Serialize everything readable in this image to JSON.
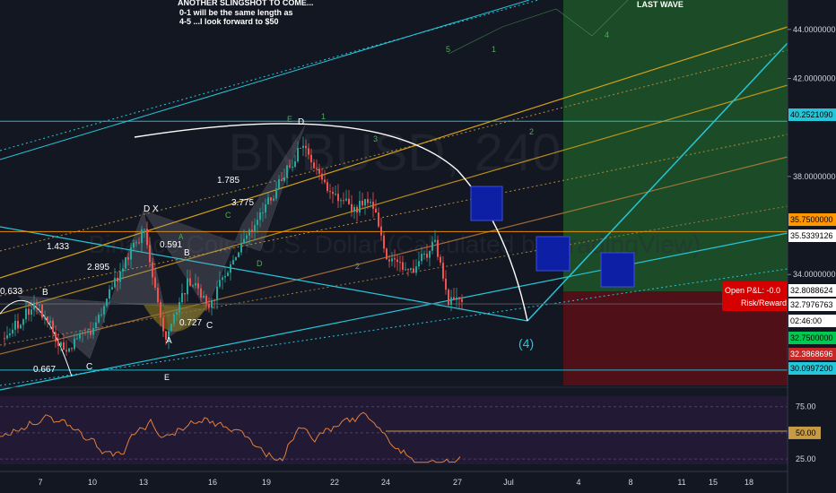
{
  "chart_data": {
    "type": "line",
    "symbol": "BNBUSD, 240",
    "description": "Binance Coin / U.S. Dollar (Calculated by TradingView)",
    "notes": [
      "ANOTHER SLINGSHOT TO COME...",
      "0-1 will be the same length as",
      "4-5 ...I look forward to $50"
    ],
    "label_last_wave": "LAST WAVE",
    "x_ticks": [
      "7",
      "10",
      "13",
      "16",
      "19",
      "22",
      "24",
      "27",
      "Jul",
      "4",
      "8",
      "11",
      "15",
      "18"
    ],
    "price_scale": {
      "ylim": [
        29.4,
        45.2
      ],
      "ticks": [
        "44.0000000",
        "42.0000000",
        "38.0000000",
        "34.0000000"
      ],
      "tick_values": [
        44,
        42,
        38,
        34
      ],
      "levels": [
        {
          "label": "40.2521090",
          "value": 40.2521,
          "color": "#26c6da",
          "text": "#000000"
        },
        {
          "label": "35.7500000",
          "value": 35.75,
          "color": "#ff9800",
          "text": "#000000"
        },
        {
          "label": "35.5339126",
          "value": 35.5339,
          "color": "#ffffff",
          "text": "#000000"
        },
        {
          "label": "32.8088624",
          "value": 32.8089,
          "color": "#ffffff",
          "text": "#000000"
        },
        {
          "label": "32.7976763",
          "value": 32.7977,
          "color": "#ffffff",
          "text": "#000000"
        },
        {
          "label": "02:46:00",
          "value": 32.3,
          "color": "#ffffff",
          "text": "#000000"
        },
        {
          "label": "32.7500000",
          "value": 32.75,
          "color": "#00c853",
          "text": "#000000"
        },
        {
          "label": "32.3868696",
          "value": 32.3869,
          "color": "#c62828",
          "text": "#ffffff"
        },
        {
          "label": "30.0997200",
          "value": 30.0997,
          "color": "#26c6da",
          "text": "#000000"
        }
      ]
    },
    "position": {
      "pnl_label": "Open P&L: -0.0",
      "rr_label": "Risk/Reward"
    },
    "pattern_labels": [
      "0.633",
      "B",
      "1.433",
      "2.895",
      "0.667",
      "C",
      "D",
      "X",
      "0.591",
      "A",
      "B",
      "0.727",
      "A",
      "C",
      "E",
      "1.785",
      "3.775",
      "C",
      "D",
      "E",
      "D",
      "1",
      "3",
      "2",
      "5",
      "1",
      "2",
      "4",
      "(4)"
    ],
    "rsi": {
      "ylim": [
        20,
        85
      ],
      "ticks": [
        "75.00",
        "50.00",
        "25.00"
      ],
      "tick_values": [
        75,
        50,
        25
      ],
      "current_label": "50.00"
    }
  }
}
